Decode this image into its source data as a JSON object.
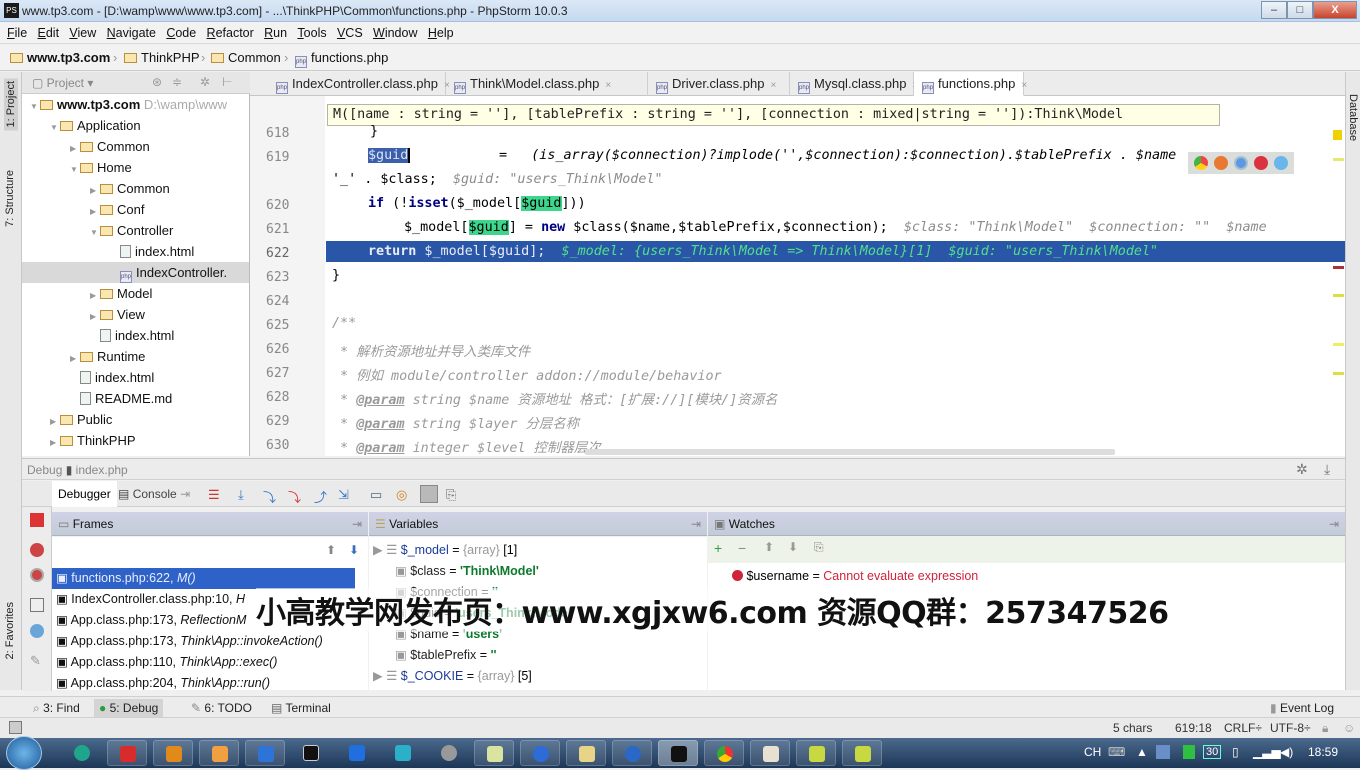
{
  "window": {
    "title": "www.tp3.com - [D:\\wamp\\www\\www.tp3.com] - ...\\ThinkPHP\\Common\\functions.php - PhpStorm 10.0.3",
    "app_icon": "PS",
    "controls": {
      "minimize": "–",
      "maximize": "□",
      "close": "X"
    }
  },
  "menu": [
    "File",
    "Edit",
    "View",
    "Navigate",
    "Code",
    "Refactor",
    "Run",
    "Tools",
    "VCS",
    "Window",
    "Help"
  ],
  "breadcrumb": [
    "www.tp3.com",
    "ThinkPHP",
    "Common",
    "functions.php"
  ],
  "left_strip": {
    "project": "1: Project",
    "structure": "7: Structure",
    "favorites": "2: Favorites"
  },
  "right_strip": {
    "database": "Database"
  },
  "project_panel": {
    "title": "Project",
    "tree": [
      {
        "label": "www.tp3.com",
        "suffix": "D:\\wamp\\www",
        "type": "folder",
        "depth": 0,
        "bold": true,
        "expanded": true
      },
      {
        "label": "Application",
        "type": "folder",
        "depth": 1,
        "expanded": true
      },
      {
        "label": "Common",
        "type": "folder",
        "depth": 2
      },
      {
        "label": "Home",
        "type": "folder",
        "depth": 2,
        "expanded": true
      },
      {
        "label": "Common",
        "type": "folder",
        "depth": 3
      },
      {
        "label": "Conf",
        "type": "folder",
        "depth": 3
      },
      {
        "label": "Controller",
        "type": "folder",
        "depth": 3,
        "expanded": true
      },
      {
        "label": "index.html",
        "type": "html",
        "depth": 4
      },
      {
        "label": "IndexController.",
        "type": "php",
        "depth": 4,
        "selected": true
      },
      {
        "label": "Model",
        "type": "folder",
        "depth": 3
      },
      {
        "label": "View",
        "type": "folder",
        "depth": 3
      },
      {
        "label": "index.html",
        "type": "html",
        "depth": 3
      },
      {
        "label": "Runtime",
        "type": "folder",
        "depth": 2
      },
      {
        "label": "index.html",
        "type": "html",
        "depth": 2
      },
      {
        "label": "README.md",
        "type": "md",
        "depth": 2
      },
      {
        "label": "Public",
        "type": "folder",
        "depth": 1
      },
      {
        "label": "ThinkPHP",
        "type": "folder",
        "depth": 1
      }
    ]
  },
  "tabs": [
    {
      "label": "IndexController.class.php",
      "active": false
    },
    {
      "label": "Think\\Model.class.php",
      "active": false
    },
    {
      "label": "Driver.class.php",
      "active": false
    },
    {
      "label": "Mysql.class.php",
      "active": false
    },
    {
      "label": "functions.php",
      "active": true
    }
  ],
  "editor": {
    "param_hint": "M([name : string = ''], [tablePrefix : string = ''], [connection : mixed|string = '']):Think\\Model",
    "line_numbers": [
      "618",
      "619",
      "620",
      "621",
      "622",
      "623",
      "624",
      "625",
      "626",
      "627",
      "628",
      "629",
      "630"
    ],
    "lines": {
      "l618": "}",
      "l619_var": "$guid",
      "l619_rest": "=   (is_array($connection)?implode('',$connection):$connection).$tablePrefix . $name",
      "l619_cont": "'_' . $class;",
      "l619_inline": "$guid: \"users_Think\\Model\"",
      "l620_kw": "if",
      "l620_a": " (!",
      "l620_isset": "isset",
      "l620_b": "($_model[",
      "l620_guid": "$guid",
      "l620_c": "]))",
      "l621_a": "$_model[",
      "l621_guid": "$guid",
      "l621_b": "] = ",
      "l621_new": "new",
      "l621_c": " $class($name,$tablePrefix,$connection);",
      "l621_inline": "$class: \"Think\\Model\"  $connection: \"\"  $name",
      "l622_kw": "return",
      "l622_a": " $_model[$guid];",
      "l622_inline": "$_model: {users_Think\\Model => Think\\Model}[1]  $guid: \"users_Think\\Model\"",
      "l623": "}",
      "l624": "",
      "l625": "/**",
      "l626": " * 解析资源地址并导入类库文件",
      "l627": " * 例如 module/controller addon://module/behavior",
      "l628_tag": "@param",
      "l628": " string $name 资源地址 格式：[扩展://][模块/]资源名",
      "l629_tag": "@param",
      "l629": " string $layer 分层名称",
      "l630_tag": "@param",
      "l630": " integer $level 控制器层次"
    }
  },
  "debug": {
    "header": "Debug",
    "config": "index.php",
    "tabs": {
      "debugger": "Debugger",
      "console": "Console"
    },
    "frames": {
      "title": "Frames",
      "items": [
        {
          "file": "functions.php:622,",
          "fn": "M()",
          "selected": true
        },
        {
          "file": "IndexController.class.php:10,",
          "fn": "H"
        },
        {
          "file": "App.class.php:173,",
          "fn": "ReflectionM"
        },
        {
          "file": "App.class.php:173,",
          "fn": "Think\\App::invokeAction()"
        },
        {
          "file": "App.class.php:110,",
          "fn": "Think\\App::exec()"
        },
        {
          "file": "App.class.php:204,",
          "fn": "Think\\App::run()"
        }
      ]
    },
    "variables": {
      "title": "Variables",
      "items": [
        {
          "name": "$_model",
          "eq": " = ",
          "type": "{array}",
          "value": " [1]",
          "expandable": true
        },
        {
          "name": "$class",
          "eq": " = ",
          "value": "'Think\\Model'",
          "string": true
        },
        {
          "name": "$connection",
          "eq": " = ",
          "value": "''",
          "string": true
        },
        {
          "name": "$guid",
          "eq": " = ",
          "value": "'users_Think\\Model'",
          "string": true
        },
        {
          "name": "$name",
          "eq": " = ",
          "value": "'users'",
          "string": true
        },
        {
          "name": "$tablePrefix",
          "eq": " = ",
          "value": "''",
          "string": true
        },
        {
          "name": "$_COOKIE",
          "eq": " = ",
          "type": "{array}",
          "value": " [5]",
          "expandable": true
        }
      ]
    },
    "watches": {
      "title": "Watches",
      "items": [
        {
          "name": "$username",
          "eq": " = ",
          "value": "Cannot evaluate expression",
          "error": true
        }
      ]
    }
  },
  "bottom_tools": [
    {
      "label": "3: Find",
      "active": false
    },
    {
      "label": "5: Debug",
      "active": true
    },
    {
      "label": "6: TODO",
      "active": false
    },
    {
      "label": "Terminal",
      "active": false
    }
  ],
  "event_log": "Event Log",
  "status": {
    "selection": "5 chars",
    "position": "619:18",
    "line_sep": "CRLF÷",
    "encoding": "UTF-8÷"
  },
  "overlay_text": "小高教学网发布页：www.xgjxw6.com  资源QQ群：257347526",
  "taskbar": {
    "ime": "CH",
    "calendar_day": "30",
    "clock": "18:59"
  },
  "colors": {
    "exec_line": "#2a56a8",
    "frame_selected": "#2f62c8",
    "highlight": "#3dd68c",
    "error": "#d0233a"
  }
}
